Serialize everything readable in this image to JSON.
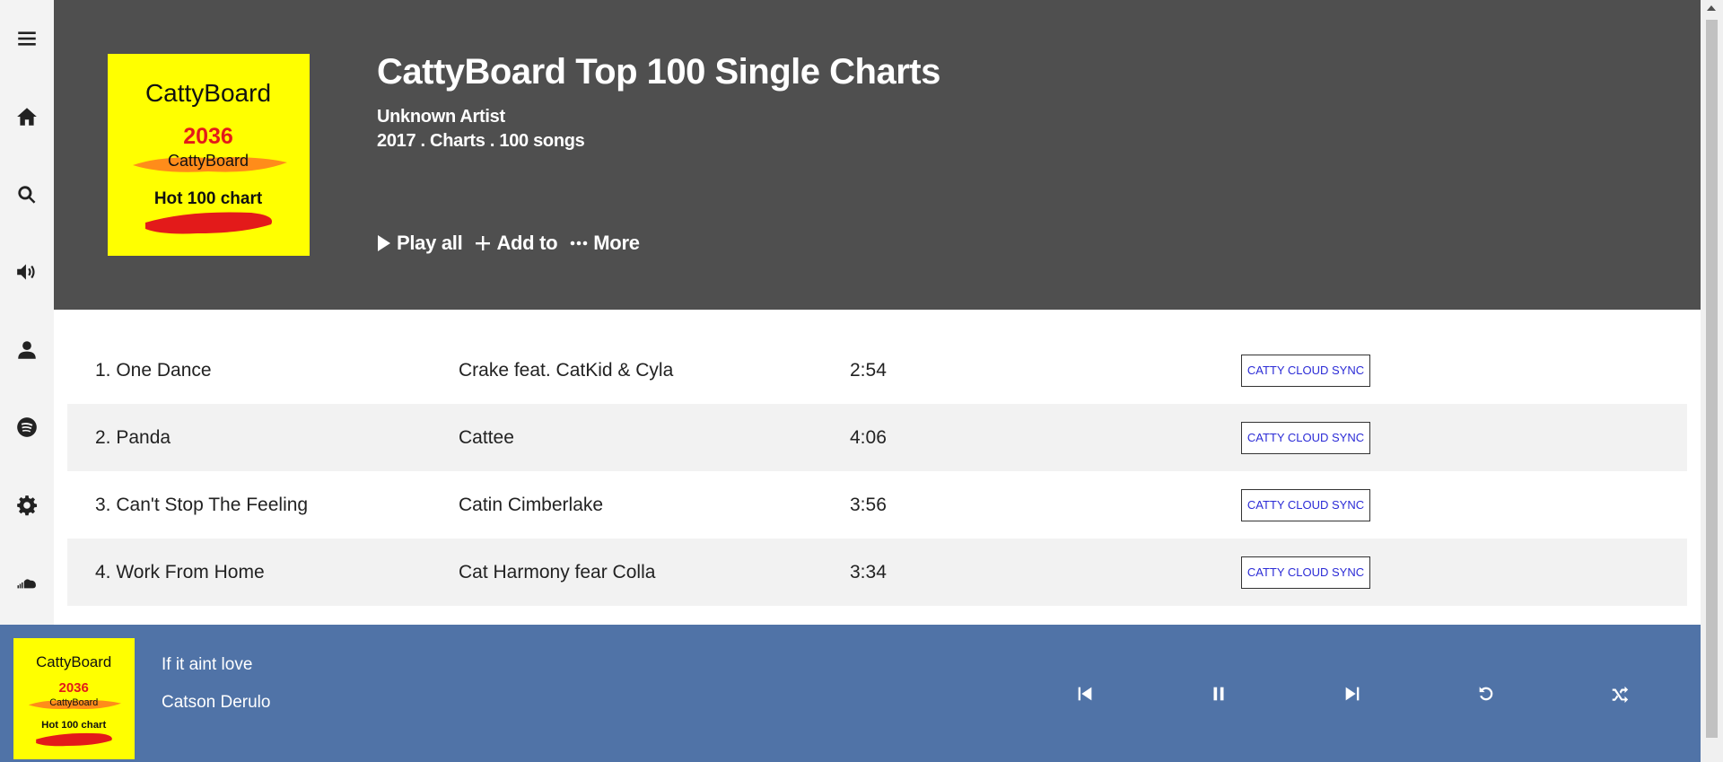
{
  "sidebar": {
    "icons": [
      "menu-icon",
      "home-icon",
      "search-icon",
      "volume-icon",
      "user-icon",
      "spotify-icon",
      "gear-icon",
      "soundcloud-icon"
    ]
  },
  "album": {
    "title": "CattyBoard Top 100 Single Charts",
    "artist": "Unknown Artist",
    "meta": "2017 . Charts . 100 songs",
    "cover": {
      "brand": "CattyBoard",
      "year": "2036",
      "sub_brand": "CattyBoard",
      "chart": "Hot 100 chart"
    }
  },
  "actions": {
    "play_all": "Play all",
    "add_to": "Add to",
    "more": "More"
  },
  "tracks": [
    {
      "title": "1. One Dance",
      "artist": "Crake feat. CatKid & Cyla",
      "duration": "2:54",
      "button": "CATTY CLOUD SYNC"
    },
    {
      "title": "2. Panda",
      "artist": "Cattee",
      "duration": "4:06",
      "button": "CATTY CLOUD SYNC"
    },
    {
      "title": "3. Can't Stop The Feeling",
      "artist": "Catin Cimberlake",
      "duration": "3:56",
      "button": "CATTY CLOUD SYNC"
    },
    {
      "title": "4. Work From Home",
      "artist": "Cat Harmony fear Colla",
      "duration": "3:34",
      "button": "CATTY CLOUD SYNC"
    }
  ],
  "player": {
    "title": "If it aint love",
    "artist": "Catson Derulo",
    "controls": [
      "previous-icon",
      "pause-icon",
      "next-icon",
      "repeat-icon",
      "shuffle-icon"
    ]
  },
  "colors": {
    "header_bg": "#4f4f4f",
    "player_bg": "#5073a7",
    "sidebar_bg": "#f3f3f3",
    "cover_yellow": "#ffff00",
    "sync_text": "#2b2bd6"
  }
}
